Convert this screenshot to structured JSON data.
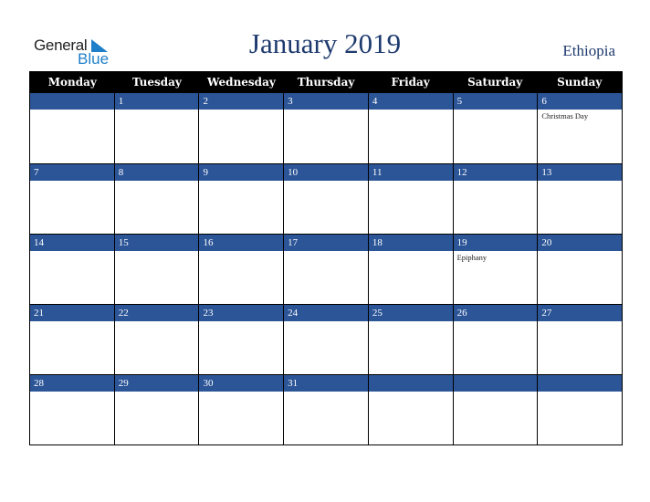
{
  "logo": {
    "general": "General",
    "blue": "Blue"
  },
  "title": "January 2019",
  "country": "Ethiopia",
  "colors": {
    "header_bg": "#000000",
    "date_bar": "#2c5597",
    "title": "#1e3a6e",
    "logo_blue": "#1f7fc9"
  },
  "weekdays": [
    "Monday",
    "Tuesday",
    "Wednesday",
    "Thursday",
    "Friday",
    "Saturday",
    "Sunday"
  ],
  "weeks": [
    [
      {
        "d": ""
      },
      {
        "d": "1"
      },
      {
        "d": "2"
      },
      {
        "d": "3"
      },
      {
        "d": "4"
      },
      {
        "d": "5"
      },
      {
        "d": "6",
        "ev": "Christmas Day"
      }
    ],
    [
      {
        "d": "7"
      },
      {
        "d": "8"
      },
      {
        "d": "9"
      },
      {
        "d": "10"
      },
      {
        "d": "11"
      },
      {
        "d": "12"
      },
      {
        "d": "13"
      }
    ],
    [
      {
        "d": "14"
      },
      {
        "d": "15"
      },
      {
        "d": "16"
      },
      {
        "d": "17"
      },
      {
        "d": "18"
      },
      {
        "d": "19",
        "ev": "Epiphany"
      },
      {
        "d": "20"
      }
    ],
    [
      {
        "d": "21"
      },
      {
        "d": "22"
      },
      {
        "d": "23"
      },
      {
        "d": "24"
      },
      {
        "d": "25"
      },
      {
        "d": "26"
      },
      {
        "d": "27"
      }
    ],
    [
      {
        "d": "28"
      },
      {
        "d": "29"
      },
      {
        "d": "30"
      },
      {
        "d": "31"
      },
      {
        "d": ""
      },
      {
        "d": ""
      },
      {
        "d": ""
      }
    ]
  ]
}
